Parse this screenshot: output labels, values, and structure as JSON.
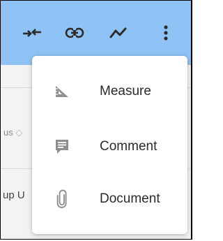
{
  "toolbar": {
    "icons": [
      "collapse-arrows-icon",
      "link-icon",
      "trend-line-icon",
      "more-vert-icon"
    ],
    "background": "#8fc3f5"
  },
  "background": {
    "row_status_label": "us",
    "row_group_label": "up U"
  },
  "menu": {
    "items": [
      {
        "label": "Measure",
        "icon": "ruler-triangle-icon"
      },
      {
        "label": "Comment",
        "icon": "comment-icon"
      },
      {
        "label": "Document",
        "icon": "paperclip-icon"
      }
    ]
  }
}
